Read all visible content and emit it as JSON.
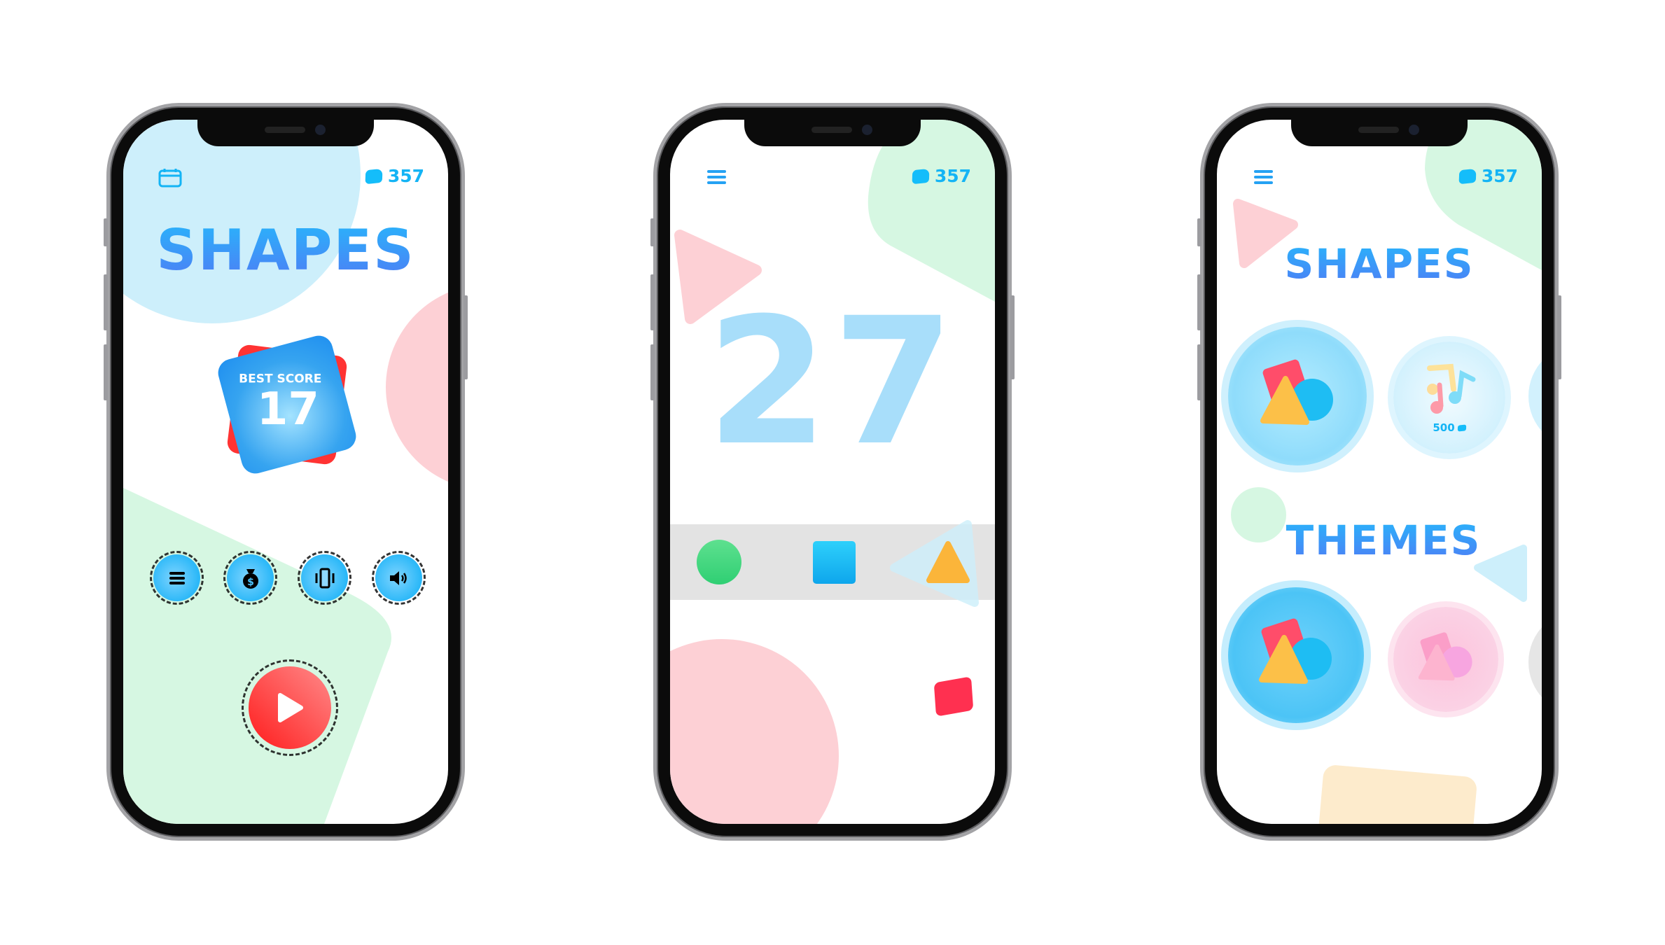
{
  "screens": [
    {
      "name": "home",
      "coins": "357",
      "title": "SHAPES",
      "best_score_label": "BEST SCORE",
      "best_score": "17",
      "icons": [
        "calendar-icon",
        "coin-icon",
        "menu-icon",
        "money-bag-icon",
        "vibration-icon",
        "sound-icon",
        "play-icon"
      ]
    },
    {
      "name": "gameplay",
      "coins": "357",
      "score": "27",
      "icons": [
        "menu-icon",
        "coin-icon"
      ],
      "shape_colors": {
        "circle": "#3ddc84",
        "square": "#18b6f0",
        "triangle": "#fbb53a"
      }
    },
    {
      "name": "shop",
      "coins": "357",
      "shapes_title": "SHAPES",
      "themes_title": "THEMES",
      "music_price": "500",
      "icons": [
        "menu-icon",
        "coin-icon",
        "shapes-pack-icon",
        "music-notes-icon"
      ]
    }
  ],
  "colors": {
    "accent": "#14b4f5",
    "title_top": "#27b7fb",
    "title_bottom": "#4f7cf5",
    "play": "#ff2b2b",
    "pale_blue": "#cdeffb",
    "pale_green": "#d6f7e2",
    "pale_pink": "#fdd0d5"
  }
}
